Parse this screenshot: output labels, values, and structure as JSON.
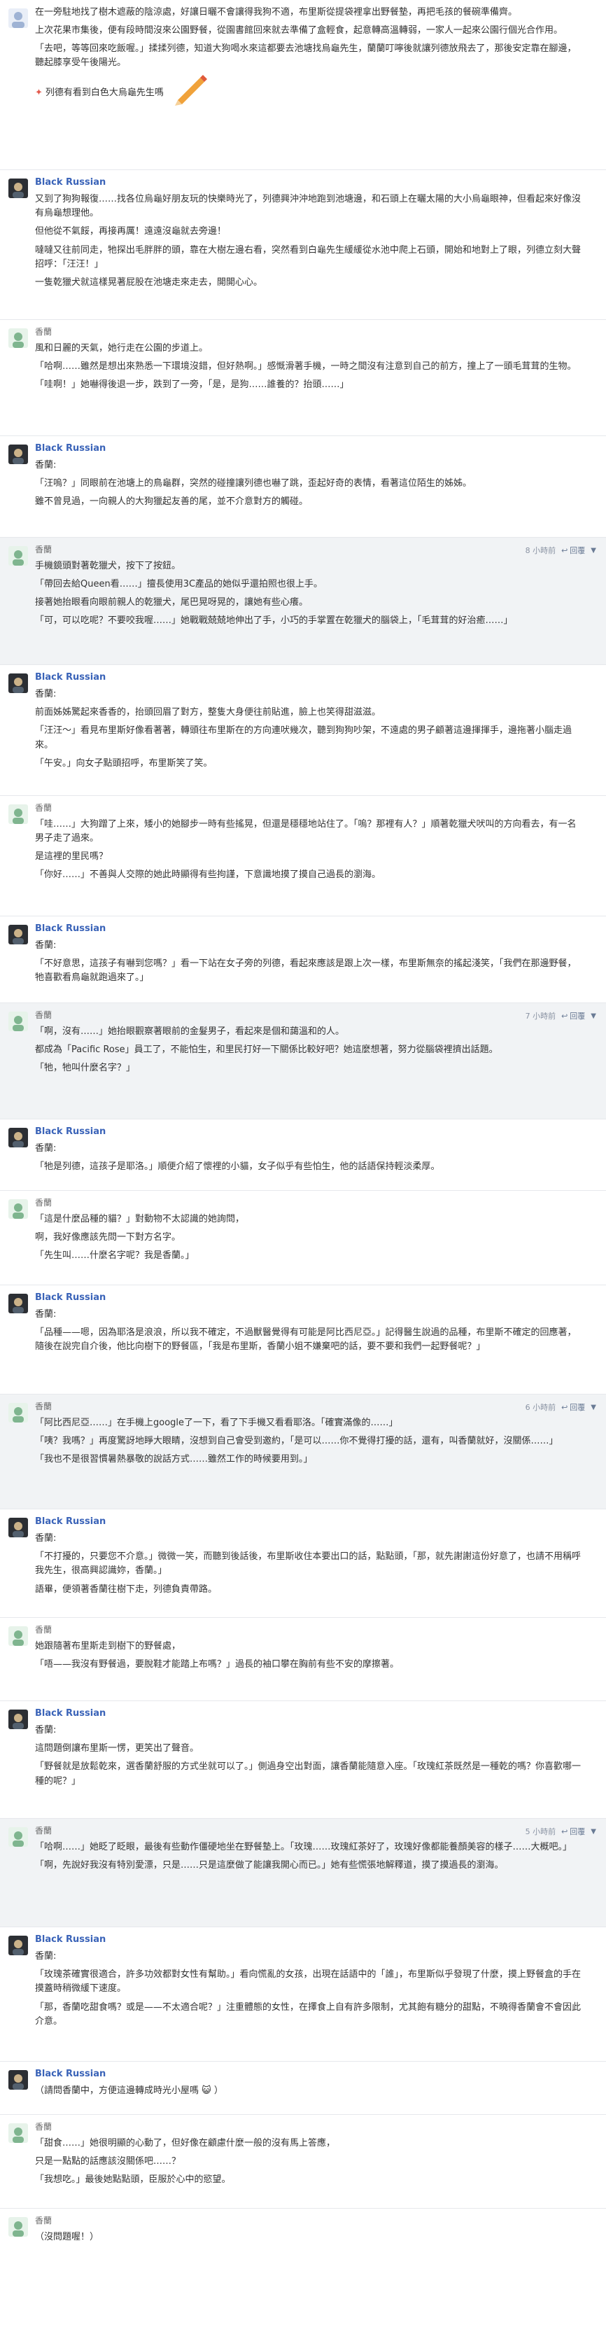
{
  "posts": [
    {
      "user": "",
      "paragraphs": [
        "在一旁駐地找了樹木遮蔽的陰涼處，好讓日曬不會讓得我狗不適，布里斯從提袋裡拿出野餐墊，再把毛孩的餐碗準備齊。",
        "上次花果市集後，便有段時間沒來公園野餐，從園書館回來就去準備了盒輕食，起意轉高溫轉弱，一家人一起來公園行個光合作用。",
        "「去吧，等等回來吃飯喔。」揉揉列德，知道大狗喝水來這都要去池塘找烏龜先生，蘭蘭叮嚀後就讓列德放飛去了，那後安定靠在腳邊，聽起膝享受午後陽光。"
      ],
      "note": "列德有看到白色大烏龜先生嗎"
    },
    {
      "user": "Black Russian",
      "paragraphs": [
        "又到了狗狗報復……找各位烏龜好朋友玩的快樂時光了，列德興沖沖地跑到池塘邊，和石頭上在曬太陽的大小烏龜眼神，但看起來好像沒有烏龜想理他。",
        "但他從不氣餒，再接再厲！遠遠沒龜就去旁邊！",
        "噠噠又往前同走，牠探出毛胖胖的頭，靠在大樹左邊右看，突然看到白龜先生緩緩從水池中爬上石頭，開始和地對上了眼，列德立刻大聲招呼：「汪汪！」",
        "一隻乾獵犬就這樣晃著屁股在池塘走來走去，開開心心。"
      ]
    },
    {
      "user": "香蘭",
      "paragraphs": [
        "風和日麗的天氣，她行走在公園的步道上。",
        "「哈啊……雖然是想出來熟悉一下環境沒錯，但好熱啊。」感慨滑著手機，一時之間沒有注意到自己的前方，撞上了一頭毛茸茸的生物。",
        "「哇啊！」她嚇得後退一步，跌到了一旁，「是，是狗……誰養的？抬頭……」"
      ]
    },
    {
      "user": "Black Russian",
      "subtitle": "香蘭:",
      "paragraphs": [
        "「汪嗚？」同眼前在池塘上的鳥龜群，突然的碰撞讓列德也嚇了跳，歪起好奇的表情，看著這位陌生的姊姊。",
        "雖不曾見過，一向親人的大狗獵起友善的尾，並不介意對方的觸碰。"
      ]
    },
    {
      "user": "香蘭",
      "time": "8 小時前",
      "reply": "回覆",
      "paragraphs": [
        "手機鏡頭對著乾獵犬，按下了按鈕。",
        "「帶回去給Queen看……」擅長使用3C產品的她似乎還拍照也很上手。",
        "接著她抬眼看向眼前親人的乾獵犬，尾巴晃呀晃的，讓她有些心癢。",
        "「可，可以吃呢？不要咬我喔……」她戰戰兢兢地伸出了手，小巧的手掌置在乾獵犬的腦袋上，「毛茸茸的好治癒……」"
      ]
    },
    {
      "user": "Black Russian",
      "subtitle": "香蘭:",
      "paragraphs": [
        "前面姊姊驚起來香香的，抬頭回眉了對方，整隻大身便往前貼進，臉上也笑得甜滋滋。",
        "「汪汪～」看見布里斯好像看著著，轉頭往布里斯在的方向連吠幾次，聽到狗狗吵架，不遠處的男子顧著這邊揮揮手，邊拖著小腦走過來。",
        "「午安。」向女子點頭招呼，布里斯笑了笑。"
      ]
    },
    {
      "user": "香蘭",
      "paragraphs": [
        "「哇……」大狗蹭了上來，矮小的她腳步一時有些搖晃，但還是穩穩地站住了。「嗚？那裡有人？」順著乾獵犬吠叫的方向看去，有一名男子走了過來。",
        "是這裡的里民嗎？",
        "「你好……」不善與人交際的她此時顯得有些拘謹，下意識地摸了摸自己過長的瀏海。"
      ]
    },
    {
      "user": "Black Russian",
      "subtitle": "香蘭:",
      "paragraphs": [
        "「不好意思，這孩子有嚇到您嗎？」看一下站在女子旁的列德，看起來應該是跟上次一樣，布里斯無奈的搖起淺笑，「我們在那邊野餐，牠喜歡看鳥龜就跑過來了。」"
      ]
    },
    {
      "user": "香蘭",
      "time": "7 小時前",
      "reply": "回覆",
      "paragraphs": [
        "「啊，沒有……」她抬眼觀察著眼前的金髮男子，看起來是個和藹溫和的人。",
        "都成為「Pacific Rose」員工了，不能怕生，和里民打好一下關係比較好吧？她這麼想著，努力從腦袋裡擠出話題。",
        "「牠，牠叫什麼名字？」"
      ]
    },
    {
      "user": "Black Russian",
      "subtitle": "香蘭:",
      "paragraphs": [
        "「牠是列德，這孩子是耶洛。」順便介紹了懷裡的小貓，女子似乎有些怕生，他的話語保持輕淡柔厚。"
      ]
    },
    {
      "user": "香蘭",
      "paragraphs": [
        "「這是什麼品種的貓？」對動物不太認識的她詢問，",
        "啊，我好像應該先問一下對方名字。",
        "「先生叫……什麼名字呢？我是香蘭。」"
      ]
    },
    {
      "user": "Black Russian",
      "subtitle": "香蘭:",
      "paragraphs": [
        "「品種——嗯，因為耶洛是浪浪，所以我不確定，不過獸醫覺得有可能是阿比西尼亞。」記得醫生說過的品種，布里斯不確定的回應著，隨後在說完自介後，他比向樹下的野餐區，「我是布里斯，香蘭小姐不嫌棄吧的話，要不要和我們一起野餐呢？」"
      ]
    },
    {
      "user": "香蘭",
      "time": "6 小時前",
      "reply": "回覆",
      "paragraphs": [
        "「阿比西尼亞……」在手機上google了一下，看了下手機又看看耶洛。「確實滿像的……」",
        "「咦？我嗎？」再度驚訝地睜大眼睛，沒想到自己會受到邀約，「是可以……你不覺得打擾的話，還有，叫香蘭就好，沒關係……」",
        "「我也不是很習慣暑熱暴敬的說話方式……雖然工作的時候要用到。」"
      ]
    },
    {
      "user": "Black Russian",
      "subtitle": "香蘭:",
      "paragraphs": [
        "「不打擾的，只要您不介意。」微微一笑，而聽到後話後，布里斯收住本要出口的話，點點頭，「那，就先謝謝這份好意了，也請不用稱呼我先生，很高興認識妳，香蘭。」",
        "語畢，便領著香蘭往樹下走，列德負責帶路。"
      ]
    },
    {
      "user": "香蘭",
      "paragraphs": [
        "她跟隨著布里斯走到樹下的野餐處，",
        "「唔——我沒有野餐過，要脫鞋才能踏上布嗎？」過長的袖口攀在胸前有些不安的摩擦著。"
      ]
    },
    {
      "user": "Black Russian",
      "subtitle": "香蘭:",
      "paragraphs": [
        "這問題倒讓布里斯一愣，更笑出了聲音。",
        "「野餐就是放鬆乾來，選香蘭舒服的方式坐就可以了。」側過身空出對面，讓香蘭能隨意入座。「玫瑰紅茶既然是一種乾的嗎？你喜歡哪一種的呢？」"
      ]
    },
    {
      "user": "香蘭",
      "time": "5 小時前",
      "reply": "回覆",
      "paragraphs": [
        "「哈啊……」她眨了眨眼，最後有些動作僵硬地坐在野餐墊上。「玫瑰……玫瑰紅茶好了，玫瑰好像都能養顏美容的樣子……大概吧。」",
        "「啊，先說好我沒有特別愛漂，只是……只是這麼做了能讓我開心而已。」她有些慌張地解釋道，摸了摸過長的瀏海。"
      ]
    },
    {
      "user": "Black Russian",
      "subtitle": "香蘭:",
      "paragraphs": [
        "「玫瑰茶確實很適合，許多功效都對女性有幫助。」看向慌亂的女孩，出現在話語中的「誰」，布里斯似乎發現了什麼，摸上野餐盒的手在摸蓋時稍微緩下速度。",
        "「那，香蘭吃甜食嗎？或是——不太適合呢？」注重體態的女性，在擇食上自有許多限制，尤其飽有糖分的甜點，不曉得香蘭會不會因此介意。"
      ]
    },
    {
      "user": "Black Russian",
      "paragraphs": [
        "（請問香蘭中，方便這邊轉成時光小屋嗎 😺 ）"
      ]
    },
    {
      "user": "香蘭",
      "paragraphs": [
        "「甜食……」她很明顯的心動了，但好像在顧慮什麼一般的沒有馬上答應，",
        "只是一點點的話應該沒關係吧……？",
        "「我想吃。」最後她點點頭，臣服於心中的慾望。"
      ]
    },
    {
      "user": "香蘭",
      "paragraphs": [
        "（沒問題喔！）"
      ]
    }
  ]
}
